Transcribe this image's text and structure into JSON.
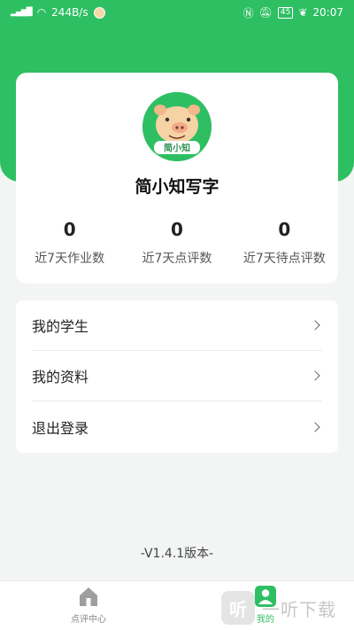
{
  "status_bar": {
    "network_speed": "244B/s",
    "battery": "45",
    "time": "20:07"
  },
  "profile": {
    "name": "简小知写字",
    "avatar_text": "简小知"
  },
  "stats": [
    {
      "value": "0",
      "label": "近7天作业数"
    },
    {
      "value": "0",
      "label": "近7天点评数"
    },
    {
      "value": "0",
      "label": "近7天待点评数"
    }
  ],
  "menu": [
    {
      "label": "我的学生"
    },
    {
      "label": "我的资料"
    },
    {
      "label": "退出登录"
    }
  ],
  "version": "-V1.4.1版本-",
  "tabs": [
    {
      "label": "点评中心",
      "icon": "home-icon",
      "active": false
    },
    {
      "label": "我的",
      "icon": "person-icon",
      "active": true
    }
  ],
  "watermark": {
    "logo_char": "听",
    "text": "一听下载"
  },
  "colors": {
    "brand_green": "#2fbf63",
    "background": "#f3f5f4"
  }
}
